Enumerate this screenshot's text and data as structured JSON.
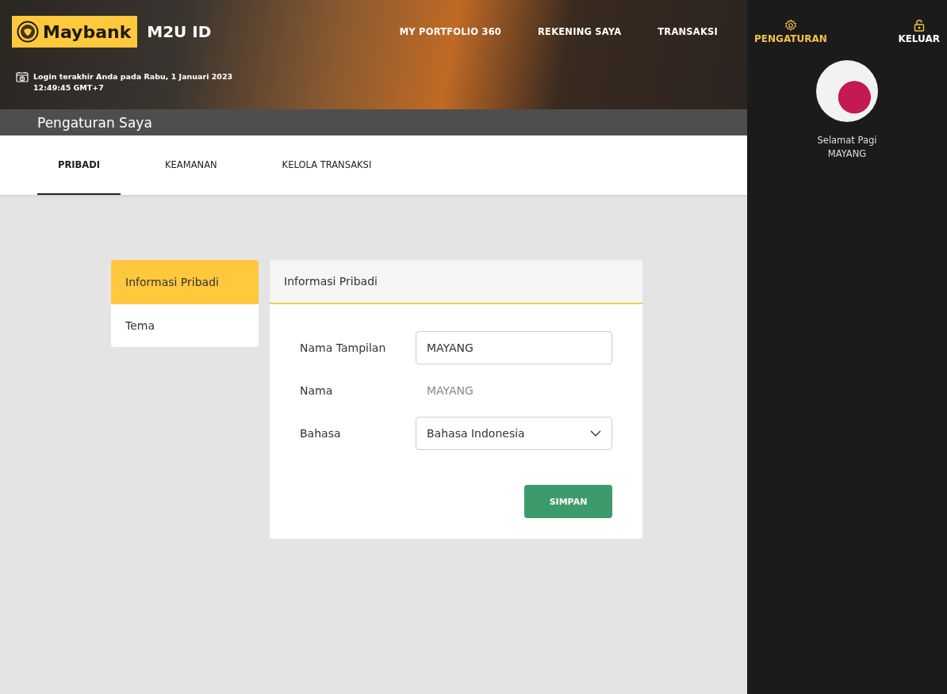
{
  "brand": {
    "logo": "Maybank",
    "product": "M2U ID"
  },
  "last_login": "Login terakhir Anda pada Rabu, 1 Januari 2023 12:49:45 GMT+7",
  "nav": [
    {
      "label": "MY PORTFOLIO 360"
    },
    {
      "label": "REKENING SAYA"
    },
    {
      "label": "TRANSAKSI"
    }
  ],
  "sidebar": {
    "actions": [
      {
        "label": "PENGATURAN",
        "kind": "settings",
        "selected": true
      },
      {
        "label": "KELUAR",
        "kind": "logout",
        "selected": false
      }
    ],
    "greeting": "Selamat Pagi",
    "user": "MAYANG"
  },
  "page_title": "Pengaturan Saya",
  "tabs": [
    {
      "label": "PRIBADI",
      "selected": true
    },
    {
      "label": "KEAMANAN",
      "selected": false
    },
    {
      "label": "KELOLA TRANSAKSI",
      "selected": false
    }
  ],
  "side_menu": [
    {
      "label": "Informasi Pribadi",
      "selected": true
    },
    {
      "label": "Tema",
      "selected": false
    }
  ],
  "panel": {
    "title": "Informasi Pribadi",
    "fields": [
      {
        "label": "Nama Tampilan",
        "kind": "input",
        "value": "MAYANG"
      },
      {
        "label": "Nama",
        "kind": "text",
        "value": "MAYANG"
      },
      {
        "label": "Bahasa",
        "kind": "select",
        "value": "Bahasa Indonesia"
      }
    ],
    "save_button": "SIMPAN"
  }
}
